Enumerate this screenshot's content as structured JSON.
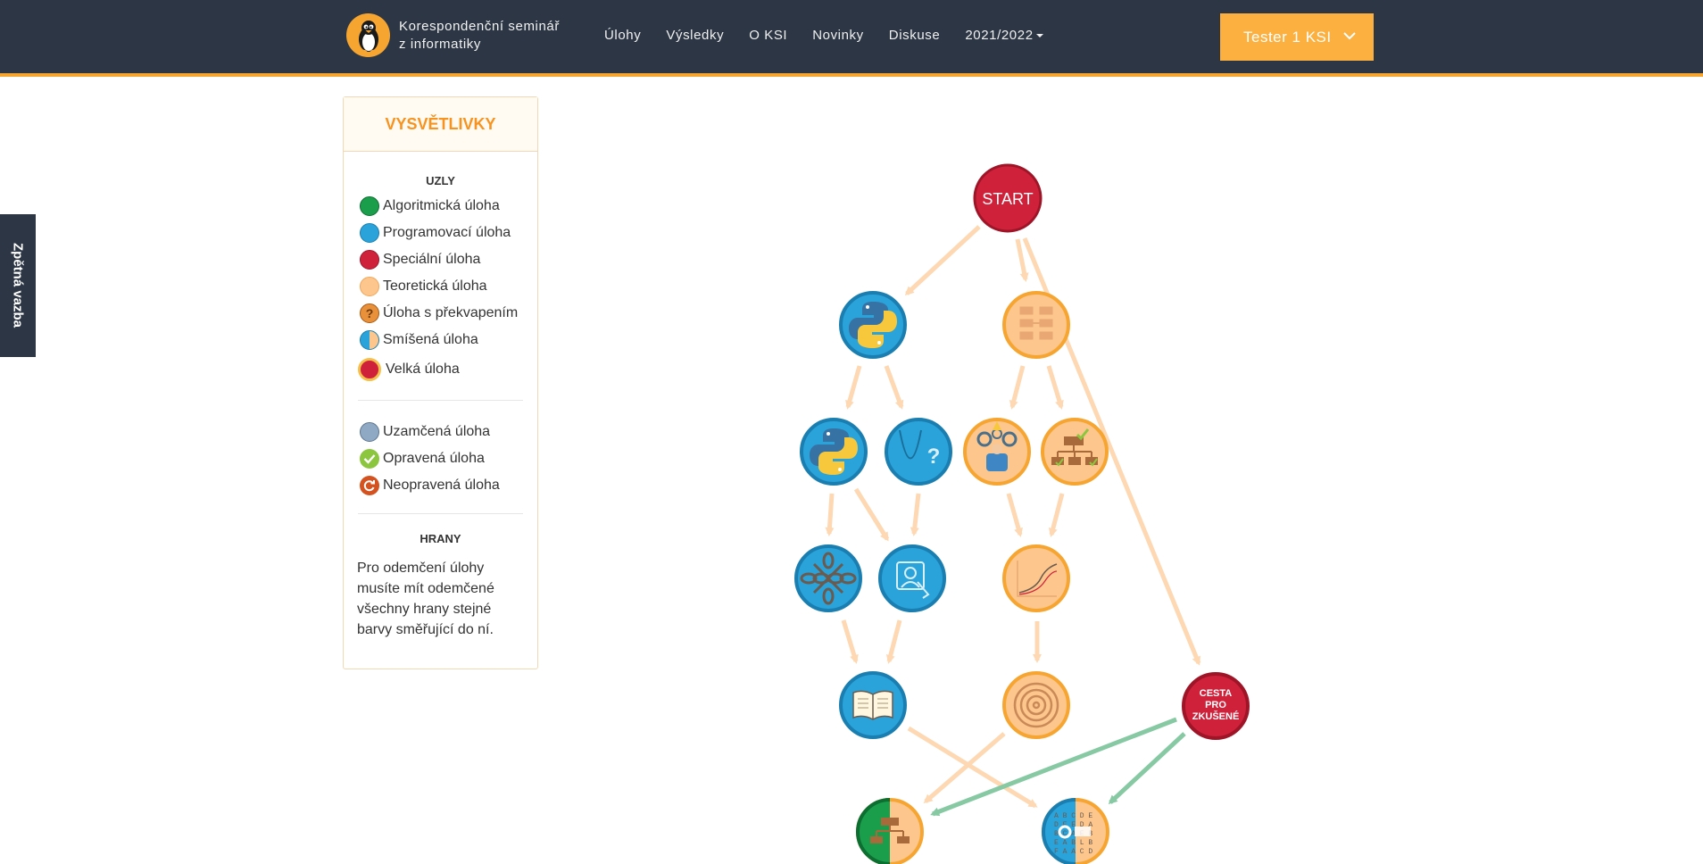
{
  "header": {
    "brand_line1": "Korespondenční seminář",
    "brand_line2": "z informatiky",
    "logo_icon": "penguin-icon",
    "nav": [
      {
        "label": "Úlohy"
      },
      {
        "label": "Výsledky"
      },
      {
        "label": "O KSI"
      },
      {
        "label": "Novinky"
      },
      {
        "label": "Diskuse"
      },
      {
        "label": "2021/2022"
      }
    ],
    "user_label": "Tester 1 KSI"
  },
  "feedback_tab": "Zpětná vazba",
  "legend": {
    "title": "VYSVĚTLIVKY",
    "nodes_title": "UZLY",
    "node_types": [
      {
        "label": "Algoritmická úloha",
        "color": "#1a9e4b"
      },
      {
        "label": "Programovací úloha",
        "color": "#2aa3db"
      },
      {
        "label": "Speciální úloha",
        "color": "#d0213b"
      },
      {
        "label": "Teoretická úloha",
        "color": "#fcc68d"
      },
      {
        "label": "Úloha s překvapením",
        "color": "#e8913a"
      },
      {
        "label": "Smíšená úloha",
        "color": "#2aa3db"
      },
      {
        "label": "Velká úloha",
        "color": "#d0213b"
      }
    ],
    "states": [
      {
        "label": "Uzamčená úloha",
        "color": "#8fa9c4"
      },
      {
        "label": "Opravená úloha",
        "color": "#8cc63f"
      },
      {
        "label": "Neopravená úloha",
        "color": "#d4521f"
      }
    ],
    "edges_title": "HRANY",
    "edges_text": "Pro odemčení úlohy musíte mít odemčené všechny hrany stejné barvy směřující do ní."
  },
  "graph": {
    "start_label": "START",
    "advanced_label_1": "CESTA",
    "advanced_label_2": "PRO",
    "advanced_label_3": "ZKUŠENÉ",
    "colors": {
      "programming": "#2aa3db",
      "theory": "#fcc68d",
      "theory_border": "#f7a531",
      "special": "#d0213b",
      "algorithmic": "#1a9e4b",
      "edge_orange": "#fdd8b2",
      "edge_green": "#86c9a3"
    }
  }
}
